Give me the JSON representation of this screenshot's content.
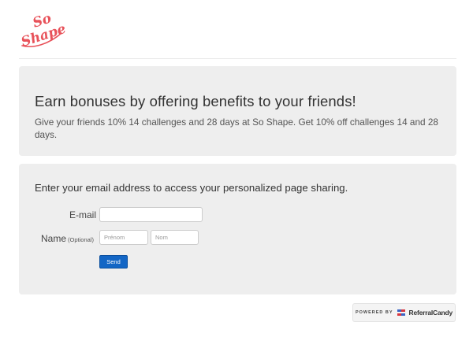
{
  "brand": {
    "name": "So Shape",
    "logo_line1": "So",
    "logo_line2": "Shape",
    "color": "#e8525a"
  },
  "hero": {
    "title": "Earn bonuses by offering benefits to your friends!",
    "text": "Give your friends 10% 14 challenges and 28 days at So Shape. Get 10% off challenges 14 and 28 days."
  },
  "form": {
    "intro": "Enter your email address to access your personalized page sharing.",
    "email_label": "E-mail",
    "email_value": "",
    "name_label": "Name",
    "name_optional": "(Optional)",
    "first_placeholder": "Prénom",
    "last_placeholder": "Nom",
    "send_label": "Send",
    "send_color": "#1366c5"
  },
  "footer": {
    "powered_by": "POWERED BY",
    "provider": "ReferralCandy",
    "provider_colors": [
      "#d9363e",
      "#3a63c4"
    ]
  }
}
